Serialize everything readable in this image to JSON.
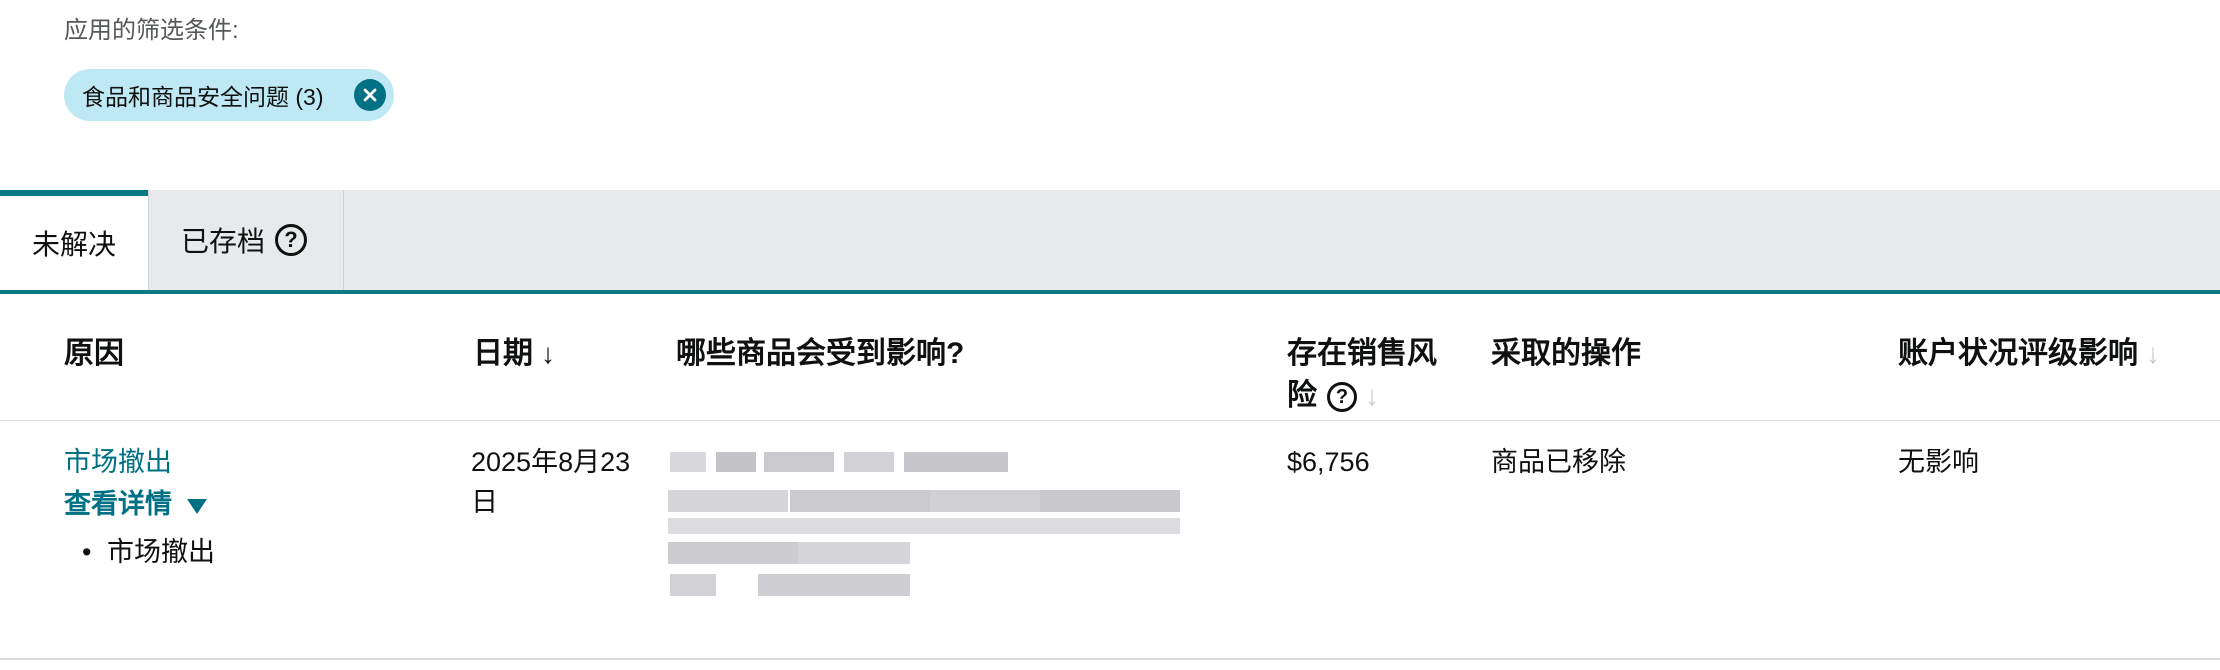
{
  "filters": {
    "label": "应用的筛选条件:",
    "chip_label": "食品和商品安全问题 (3)",
    "chip_close_icon": "close-circle-icon"
  },
  "tabs": {
    "active_label": "未解决",
    "archived_label": "已存档",
    "help_icon": "question-circle-icon"
  },
  "table": {
    "headers": {
      "reason": "原因",
      "date": "日期",
      "affected_products": "哪些商品会受到影响?",
      "sales_risk": "存在销售风险",
      "action_taken": "采取的操作",
      "health_impact": "账户状况评级影响"
    },
    "rows": [
      {
        "reason": "市场撤出",
        "details_label": "查看详情",
        "detail_item": "市场撤出",
        "date": "2025年8月23日",
        "sales_risk": "$6,756",
        "action_taken": "商品已移除",
        "health_impact": "无影响"
      }
    ]
  },
  "colors": {
    "accent": "#0a7b83",
    "link": "#007185",
    "chip_bg": "#bfe8f5",
    "tabbar_bg": "#e8e9eb"
  }
}
